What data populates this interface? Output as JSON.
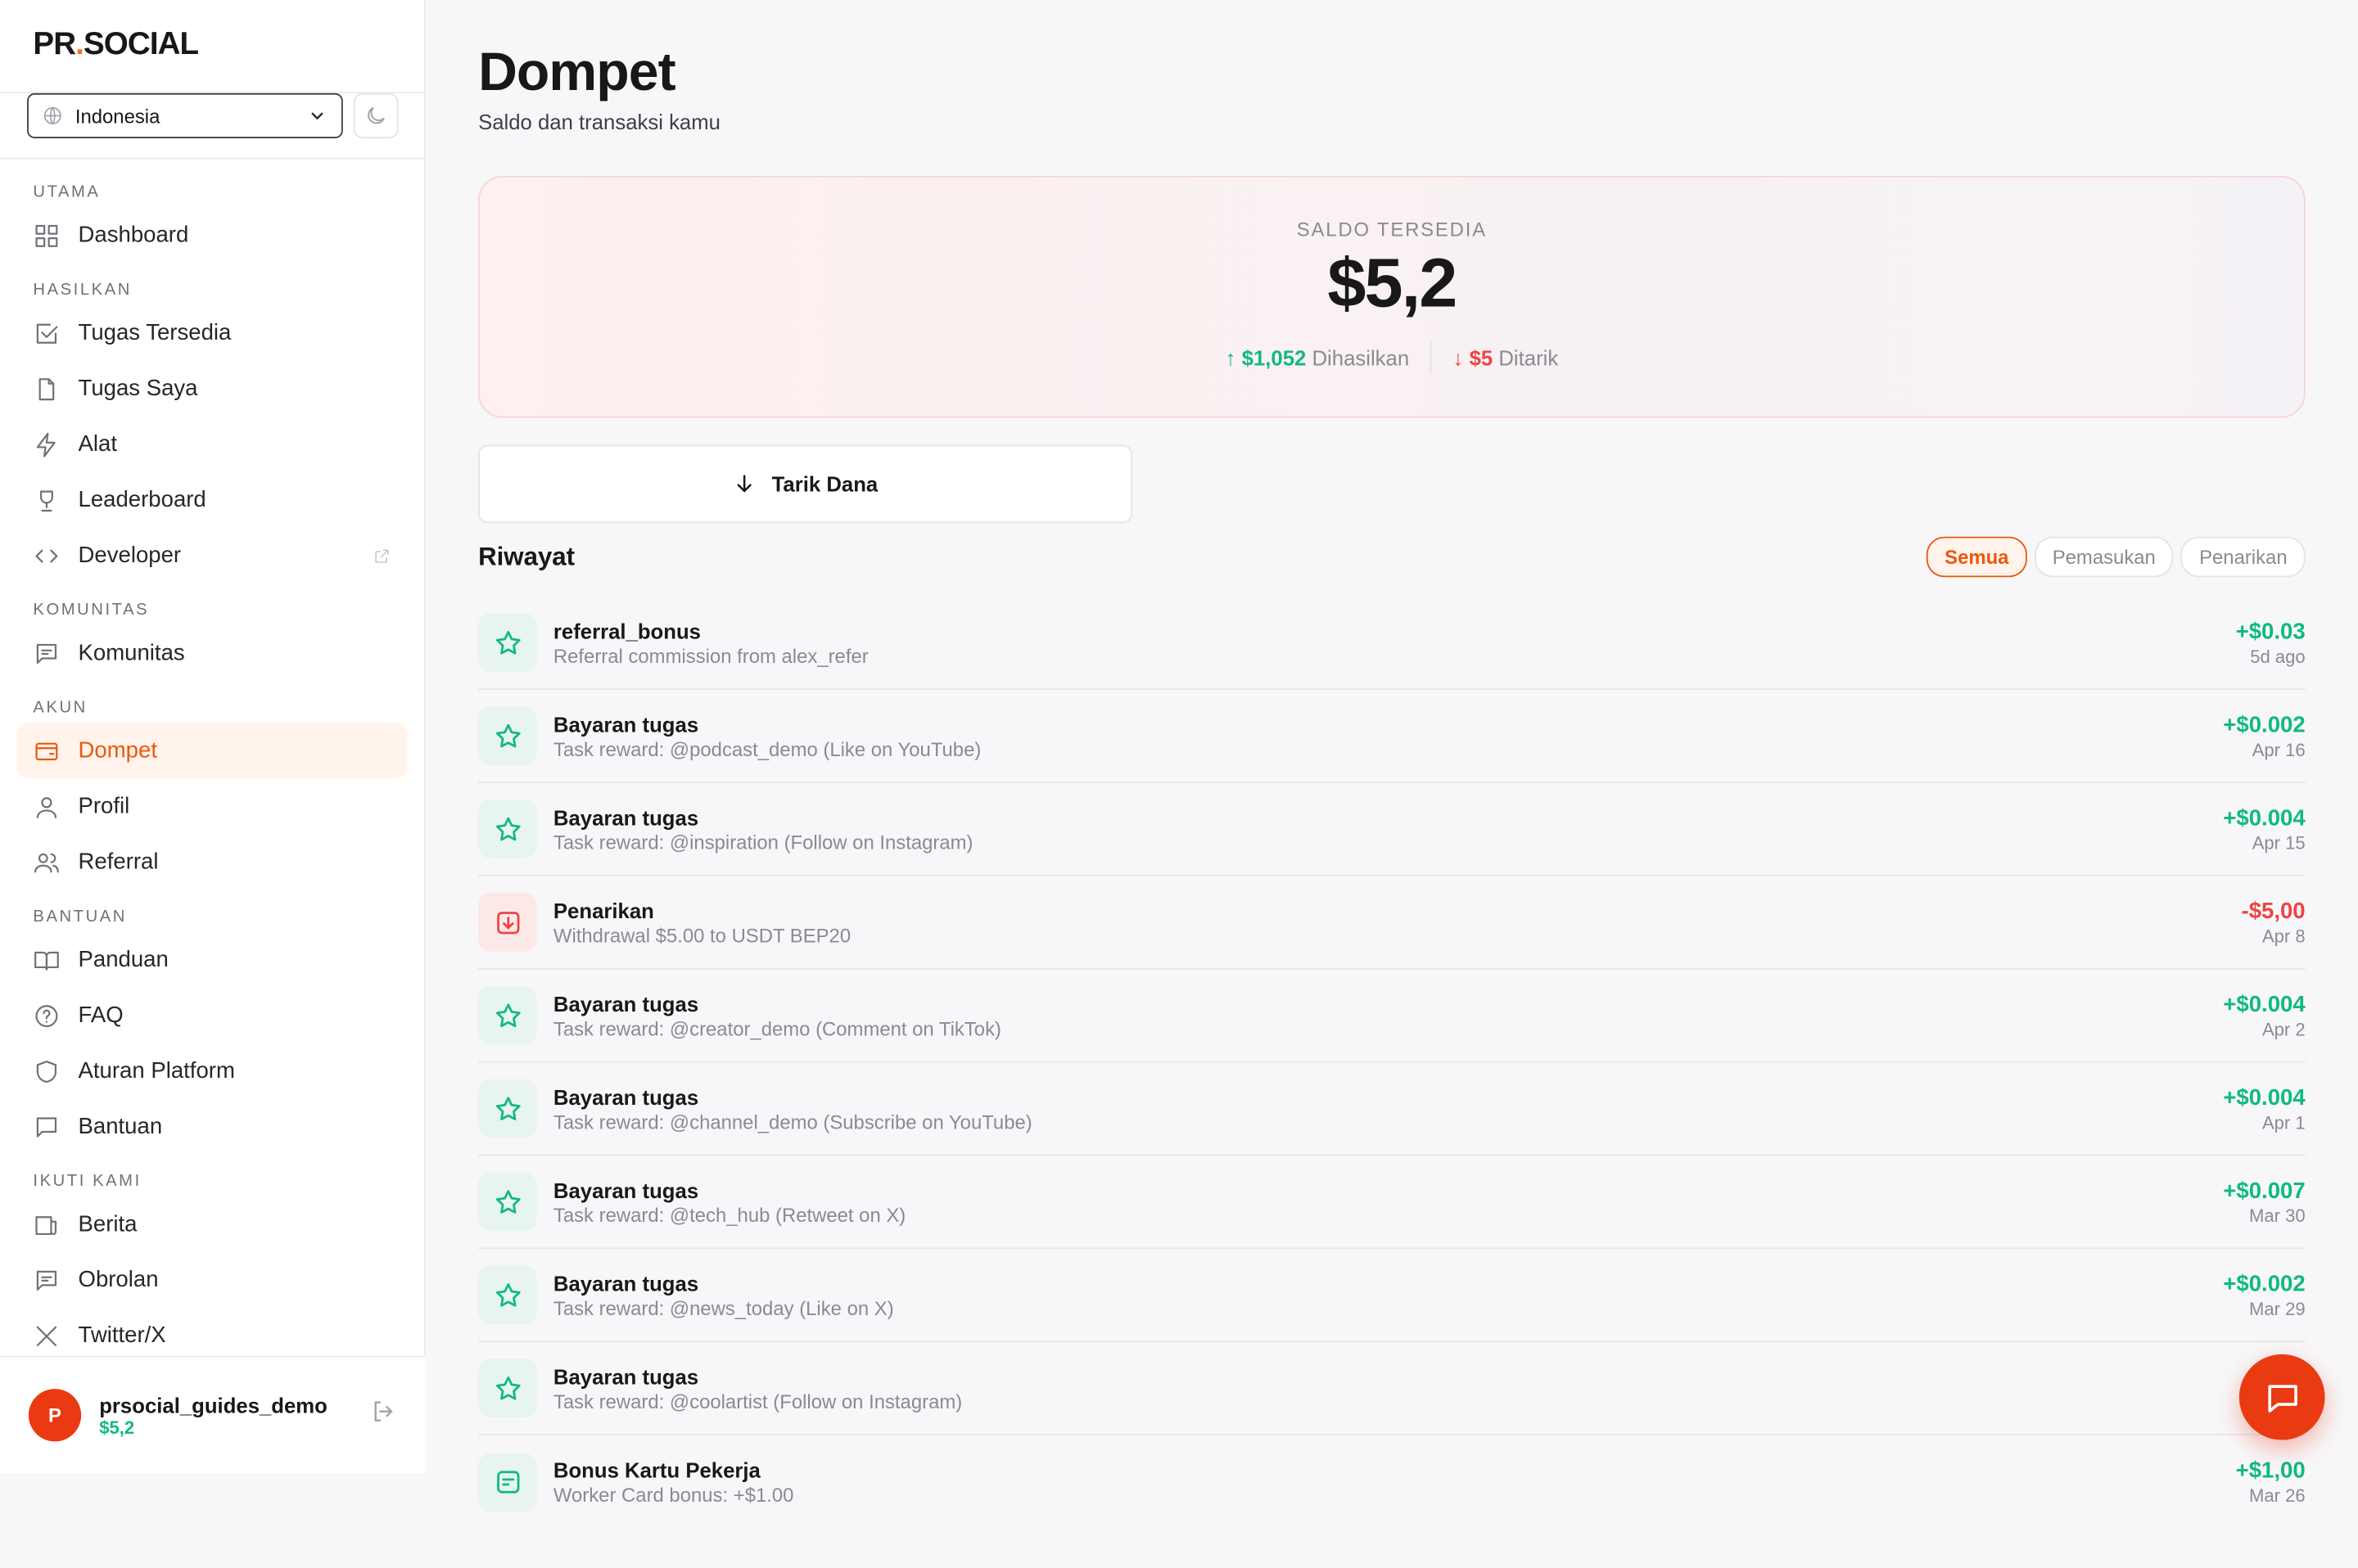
{
  "brand": {
    "name_left": "PR",
    "dot": ".",
    "name_right": "SOCIAL"
  },
  "region": {
    "selected": "Indonesia"
  },
  "nav": [
    {
      "group": "UTAMA",
      "items": [
        {
          "label": "Dashboard",
          "icon": "grid-icon"
        }
      ]
    },
    {
      "group": "HASILKAN",
      "items": [
        {
          "label": "Tugas Tersedia",
          "icon": "checkbox-icon"
        },
        {
          "label": "Tugas Saya",
          "icon": "file-icon"
        },
        {
          "label": "Alat",
          "icon": "zap-icon"
        },
        {
          "label": "Leaderboard",
          "icon": "trophy-icon"
        },
        {
          "label": "Developer",
          "icon": "code-icon",
          "external": true
        }
      ]
    },
    {
      "group": "KOMUNITAS",
      "items": [
        {
          "label": "Komunitas",
          "icon": "message-square-icon"
        }
      ]
    },
    {
      "group": "AKUN",
      "items": [
        {
          "label": "Dompet",
          "icon": "wallet-icon",
          "active": true
        },
        {
          "label": "Profil",
          "icon": "user-icon"
        },
        {
          "label": "Referral",
          "icon": "users-icon"
        }
      ]
    },
    {
      "group": "BANTUAN",
      "items": [
        {
          "label": "Panduan",
          "icon": "book-icon"
        },
        {
          "label": "FAQ",
          "icon": "help-circle-icon"
        },
        {
          "label": "Aturan Platform",
          "icon": "shield-icon"
        },
        {
          "label": "Bantuan",
          "icon": "chat-icon"
        }
      ]
    },
    {
      "group": "IKUTI KAMI",
      "items": [
        {
          "label": "Berita",
          "icon": "news-icon"
        },
        {
          "label": "Obrolan",
          "icon": "message-square-icon"
        },
        {
          "label": "Twitter/X",
          "icon": "x-icon"
        }
      ]
    }
  ],
  "user": {
    "initial": "P",
    "name": "prsocial_guides_demo",
    "balance": "$5,2"
  },
  "page": {
    "title": "Dompet",
    "subtitle": "Saldo dan transaksi kamu"
  },
  "balance": {
    "label": "SALDO TERSEDIA",
    "value": "$5,2",
    "earned_value": "$1,052",
    "earned_label": "Dihasilkan",
    "withdrawn_value": "$5",
    "withdrawn_label": "Ditarik"
  },
  "actions": {
    "withdraw_label": "Tarik Dana"
  },
  "history": {
    "title": "Riwayat",
    "filters": [
      {
        "label": "Semua",
        "active": true
      },
      {
        "label": "Pemasukan"
      },
      {
        "label": "Penarikan"
      }
    ],
    "transactions": [
      {
        "type": "reward",
        "title": "referral_bonus",
        "desc": "Referral commission from alex_refer",
        "amount": "+$0.03",
        "date": "5d ago"
      },
      {
        "type": "reward",
        "title": "Bayaran tugas",
        "desc": "Task reward: @podcast_demo (Like on YouTube)",
        "amount": "+$0.002",
        "date": "Apr 16"
      },
      {
        "type": "reward",
        "title": "Bayaran tugas",
        "desc": "Task reward: @inspiration (Follow on Instagram)",
        "amount": "+$0.004",
        "date": "Apr 15"
      },
      {
        "type": "withdraw",
        "title": "Penarikan",
        "desc": "Withdrawal $5.00 to USDT BEP20",
        "amount": "-$5,00",
        "date": "Apr 8"
      },
      {
        "type": "reward",
        "title": "Bayaran tugas",
        "desc": "Task reward: @creator_demo (Comment on TikTok)",
        "amount": "+$0.004",
        "date": "Apr 2"
      },
      {
        "type": "reward",
        "title": "Bayaran tugas",
        "desc": "Task reward: @channel_demo (Subscribe on YouTube)",
        "amount": "+$0.004",
        "date": "Apr 1"
      },
      {
        "type": "reward",
        "title": "Bayaran tugas",
        "desc": "Task reward: @tech_hub (Retweet on X)",
        "amount": "+$0.007",
        "date": "Mar 30"
      },
      {
        "type": "reward",
        "title": "Bayaran tugas",
        "desc": "Task reward: @news_today (Like on X)",
        "amount": "+$0.002",
        "date": "Mar 29"
      },
      {
        "type": "reward",
        "title": "Bayaran tugas",
        "desc": "Task reward: @coolartist (Follow on Instagram)",
        "amount": "+$0.",
        "date": ""
      },
      {
        "type": "card",
        "title": "Bonus Kartu Pekerja",
        "desc": "Worker Card bonus: +$1.00",
        "amount": "+$1,00",
        "date": "Mar 26"
      }
    ]
  },
  "colors": {
    "accent": "#ea580c",
    "positive": "#10b981",
    "negative": "#ef4444",
    "fab": "#ea3a12"
  }
}
